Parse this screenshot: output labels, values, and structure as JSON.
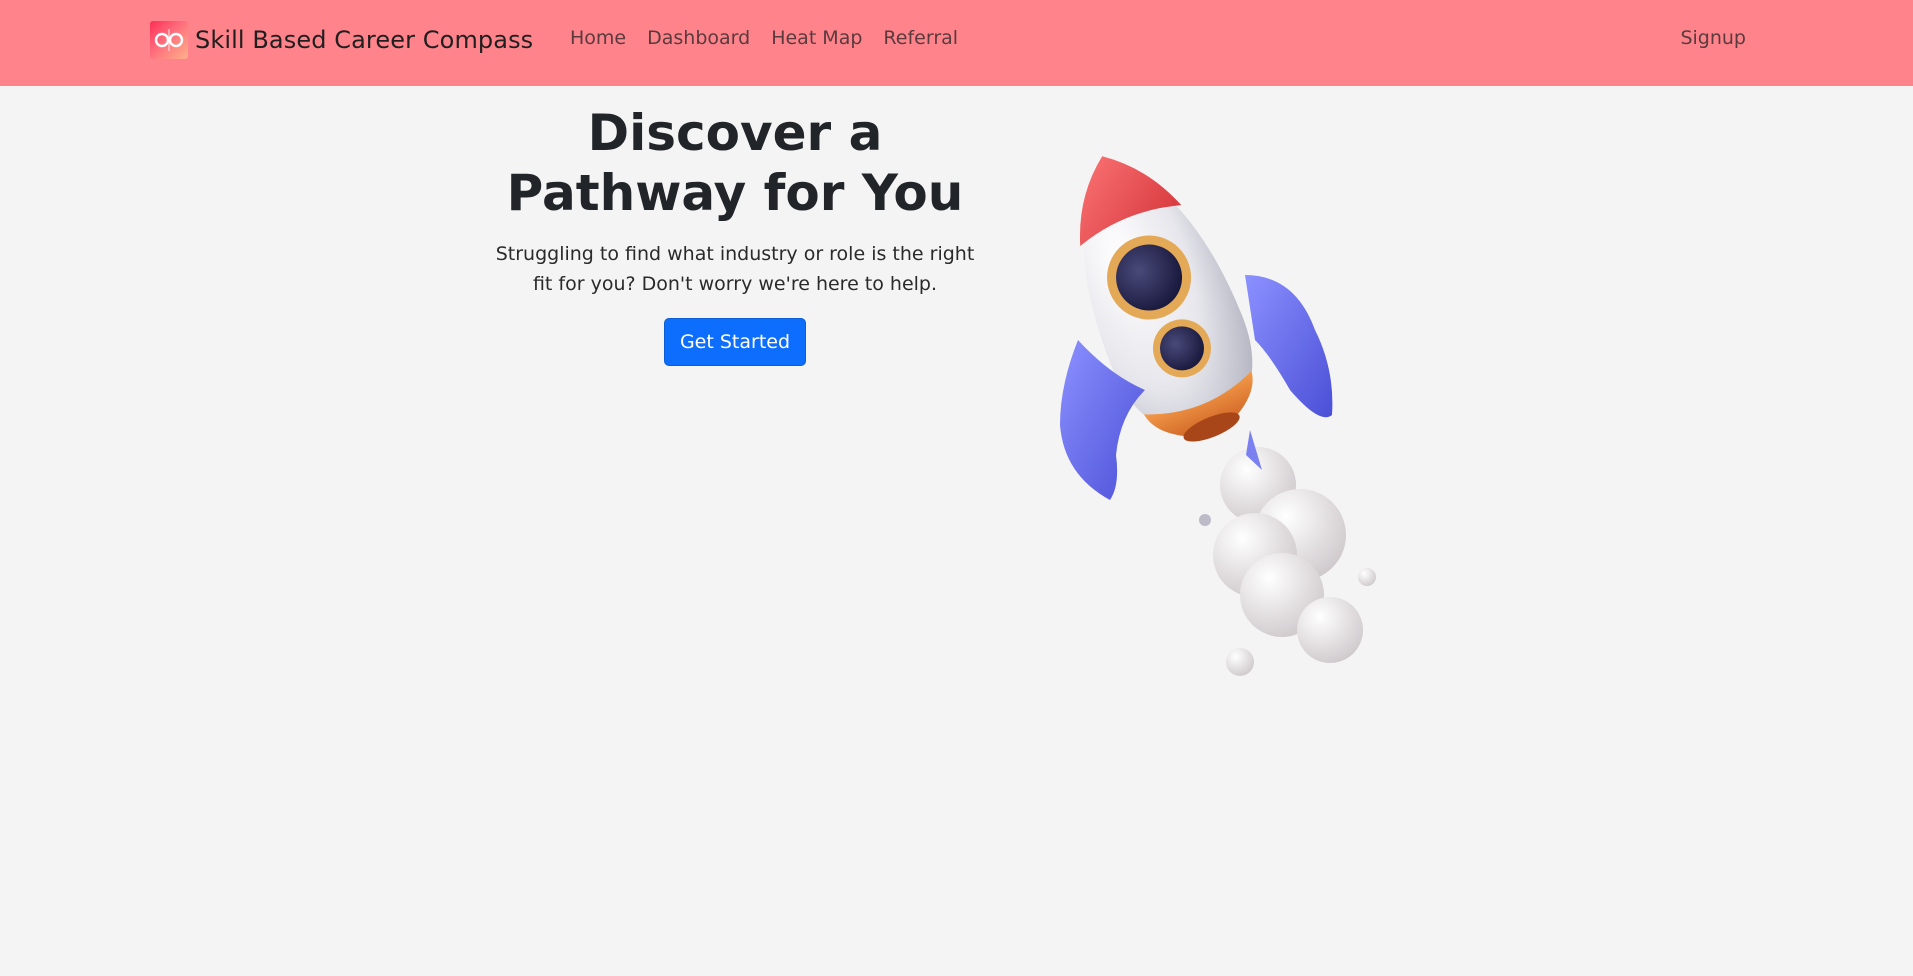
{
  "navbar": {
    "brand_name": "Skill Based Career Compass",
    "brand_logo_icon": "compass-logo-icon",
    "links": [
      {
        "label": "Home"
      },
      {
        "label": "Dashboard"
      },
      {
        "label": "Heat Map"
      },
      {
        "label": "Referral"
      }
    ],
    "signup_label": "Signup",
    "background_color": "#ff838b"
  },
  "hero": {
    "title_line1": "Discover a",
    "title_line2": "Pathway for You",
    "subtitle": "Struggling to find what industry or role is the right fit for you? Don't worry we're here to help.",
    "cta_label": "Get Started",
    "cta_color": "#0d6efd",
    "illustration_icon": "rocket-illustration"
  }
}
